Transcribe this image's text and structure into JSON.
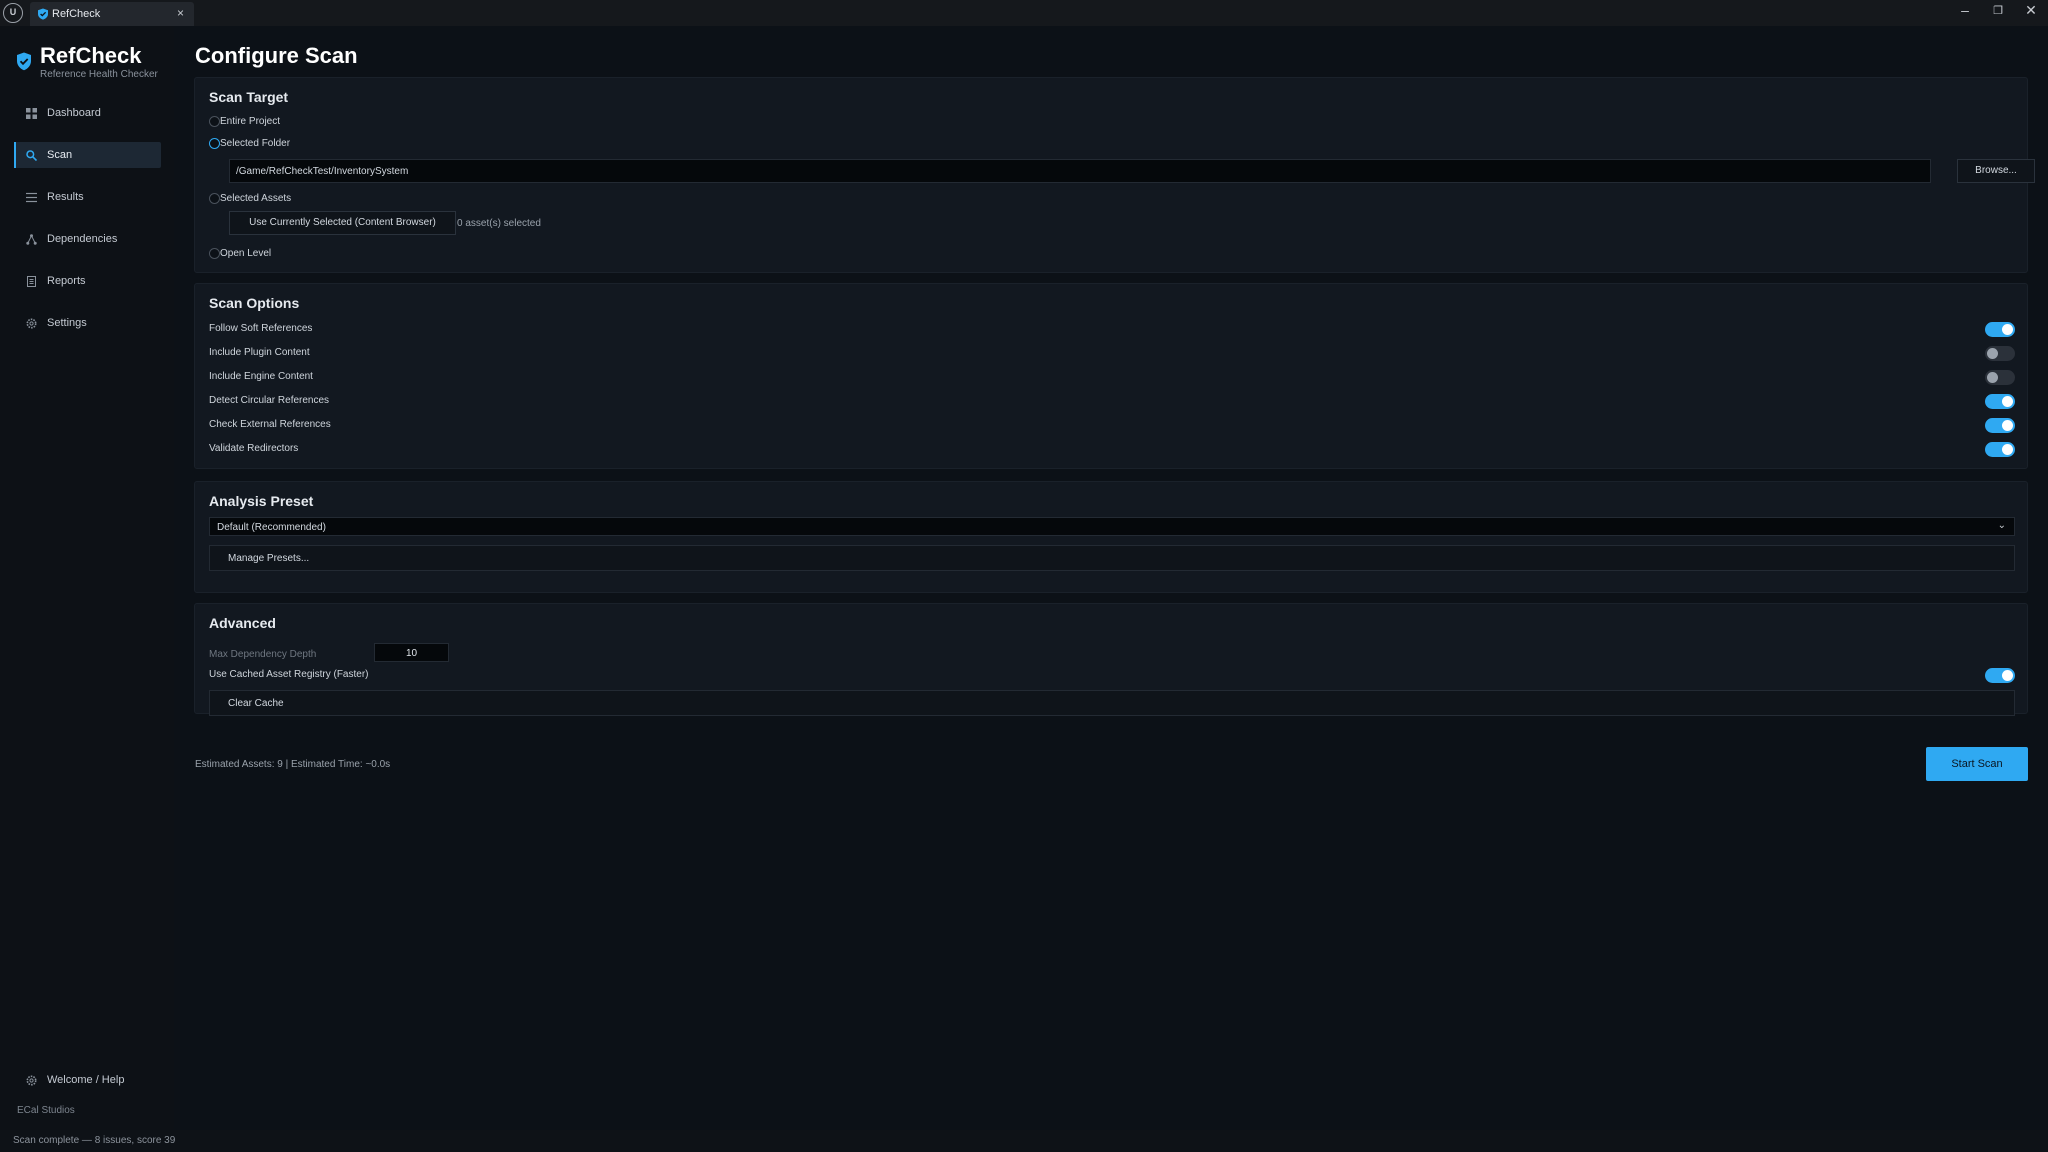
{
  "window": {
    "tab_label": "RefCheck",
    "tab_close": "×",
    "controls": {
      "minimize": "–",
      "restore": "❐",
      "close": "✕"
    },
    "engine_logo": "U"
  },
  "sidebar": {
    "brand_name": "RefCheck",
    "brand_sub": "Reference Health Checker",
    "items": [
      {
        "label": "Dashboard",
        "icon": "grid-icon"
      },
      {
        "label": "Scan",
        "icon": "search-icon",
        "active": true
      },
      {
        "label": "Results",
        "icon": "list-icon"
      },
      {
        "label": "Dependencies",
        "icon": "tree-icon"
      },
      {
        "label": "Reports",
        "icon": "document-icon"
      },
      {
        "label": "Settings",
        "icon": "gear-icon"
      }
    ],
    "help_label": "Welcome / Help",
    "studio": "ECal Studios"
  },
  "main": {
    "title": "Configure Scan",
    "scan_target": {
      "title": "Scan Target",
      "options": [
        "Entire Project",
        "Selected Folder",
        "Selected Assets",
        "Open Level"
      ],
      "selected": "Selected Folder",
      "folder_path": "/Game/RefCheckTest/InventorySystem",
      "browse_label": "Browse...",
      "use_selected_label": "Use Currently Selected (Content Browser)",
      "assets_selected": "0 asset(s) selected"
    },
    "scan_options": {
      "title": "Scan Options",
      "items": [
        {
          "label": "Follow Soft References",
          "on": true
        },
        {
          "label": "Include Plugin Content",
          "on": false
        },
        {
          "label": "Include Engine Content",
          "on": false
        },
        {
          "label": "Detect Circular References",
          "on": true
        },
        {
          "label": "Check External References",
          "on": true
        },
        {
          "label": "Validate Redirectors",
          "on": true
        }
      ]
    },
    "analysis_preset": {
      "title": "Analysis Preset",
      "selected": "Default (Recommended)",
      "manage_label": "Manage Presets..."
    },
    "advanced": {
      "title": "Advanced",
      "depth_label": "Max Dependency Depth",
      "depth_value": "10",
      "cached_label": "Use Cached Asset Registry (Faster)",
      "cached_on": true,
      "clear_cache_label": "Clear Cache"
    },
    "estimate": "Estimated Assets: 9  |  Estimated Time: ~0.0s",
    "start_label": "Start Scan"
  },
  "status": "Scan complete — 8 issues, score 39",
  "colors": {
    "accent": "#2fa9f2",
    "background": "#0c1117",
    "panel": "#121820"
  }
}
